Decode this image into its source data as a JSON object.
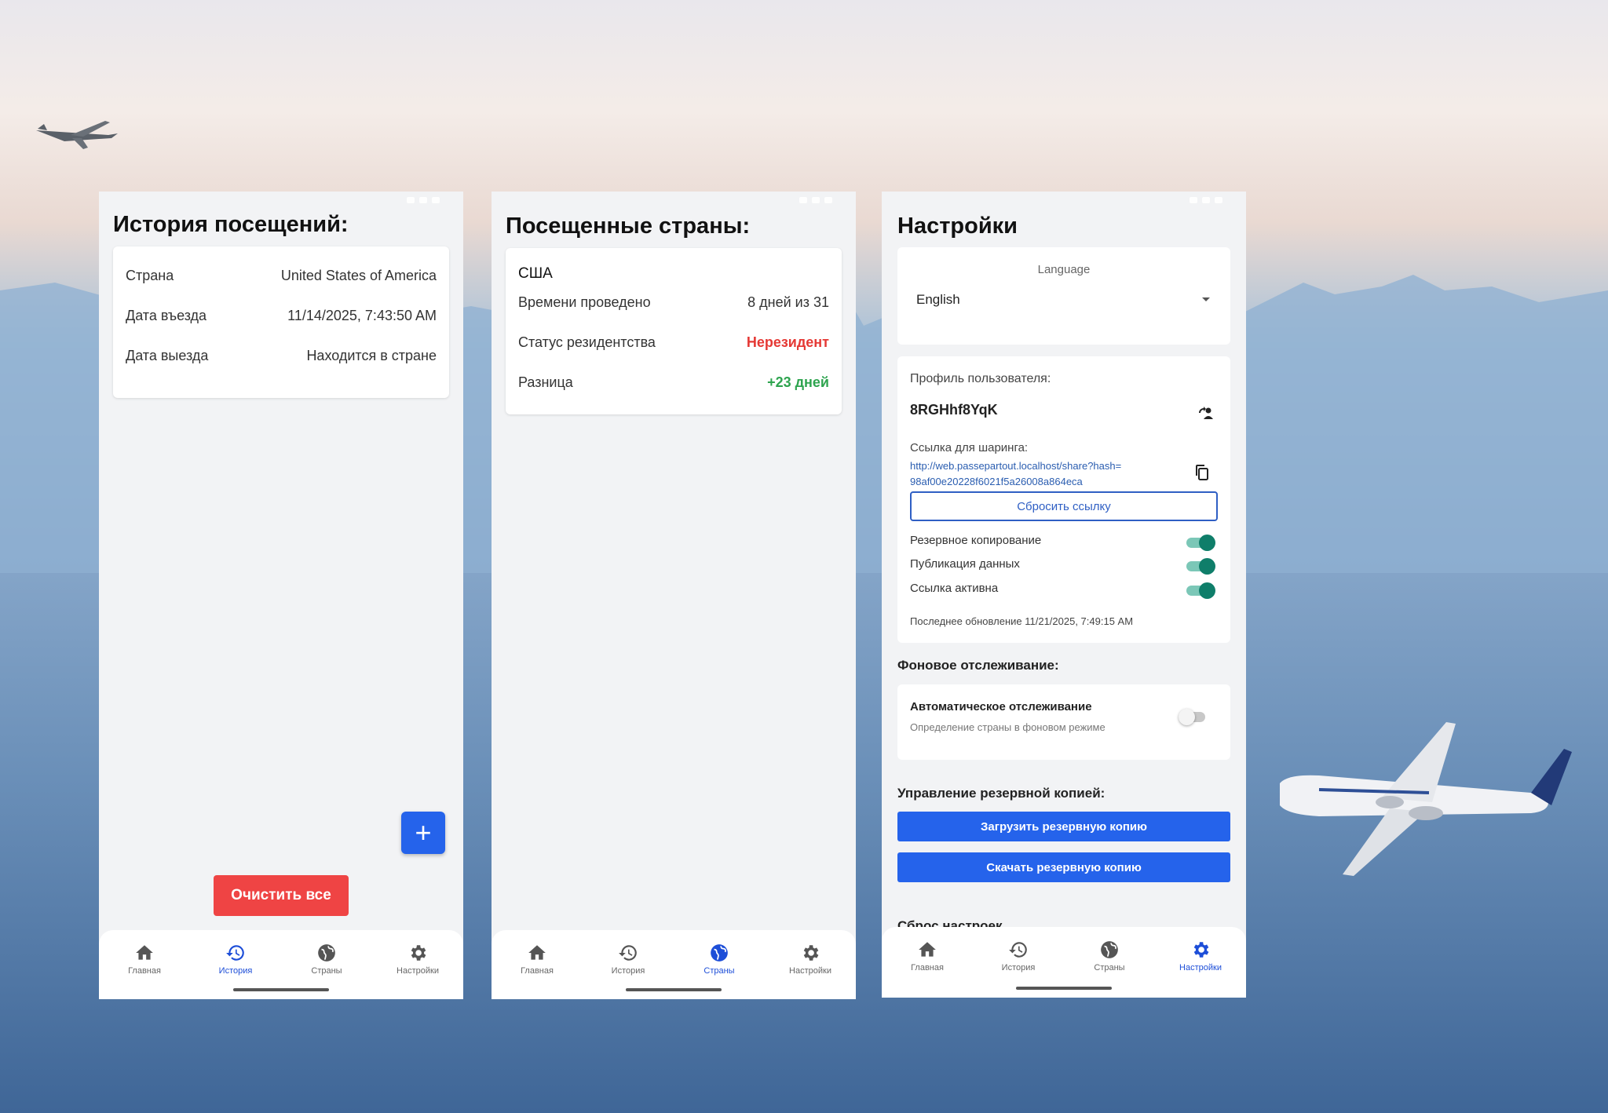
{
  "history": {
    "title": "История посещений:",
    "rows": [
      {
        "label": "Страна",
        "value": "United States of America"
      },
      {
        "label": "Дата въезда",
        "value": "11/14/2025, 7:43:50 AM"
      },
      {
        "label": "Дата выезда",
        "value": "Находится в стране"
      }
    ],
    "fab_label": "+",
    "clear_label": "Очистить все"
  },
  "countries": {
    "title": "Посещенные страны:",
    "country": "США",
    "rows": [
      {
        "label": "Времени проведено",
        "value": "8 дней из 31"
      },
      {
        "label": "Статус резидентства",
        "value": "Нерезидент"
      },
      {
        "label": "Разница",
        "value": "+23 дней"
      }
    ]
  },
  "settings": {
    "title": "Настройки",
    "language_label": "Language",
    "language_value": "English",
    "profile_label": "Профиль пользователя:",
    "profile_id": "8RGHhf8YqK",
    "share_label": "Ссылка для шаринга:",
    "share_link_line1": "http://web.passepartout.localhost/share?hash=",
    "share_link_line2": "98af00e20228f6021f5a26008a864eca",
    "reset_link_label": "Сбросить ссылку",
    "toggles": [
      {
        "label": "Резервное копирование",
        "on": true
      },
      {
        "label": "Публикация данных",
        "on": true
      },
      {
        "label": "Ссылка активна",
        "on": true
      }
    ],
    "last_update": "Последнее обновление 11/21/2025, 7:49:15 AM",
    "background_title": "Фоновое отслеживание:",
    "auto_track_label": "Автоматическое отслеживание",
    "auto_track_desc": "Определение страны в фоновом режиме",
    "auto_track_on": false,
    "backup_title": "Управление резервной копией:",
    "upload_label": "Загрузить резервную копию",
    "download_label": "Скачать резервную копию",
    "reset_title": "Сброс настроек"
  },
  "nav": {
    "items": [
      "Главная",
      "История",
      "Страны",
      "Настройки"
    ]
  },
  "colors": {
    "accent": "#2563eb",
    "danger": "#ef4444",
    "toggle_on": "#0f7e6a",
    "positive": "#2ea44f"
  },
  "icons": {
    "nav": [
      "home-icon",
      "history-icon",
      "globe-icon",
      "gear-icon"
    ],
    "profile": "swap-account-icon",
    "copy": "copy-icon",
    "dropdown": "caret-down-icon"
  }
}
